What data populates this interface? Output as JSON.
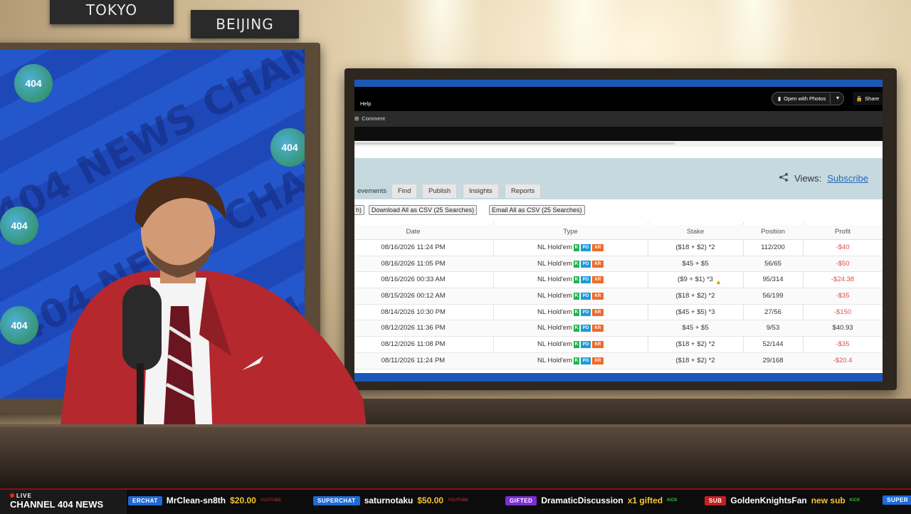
{
  "studio": {
    "city_signs": [
      "TOKYO",
      "BEIJING"
    ],
    "background_text": "404 NEWS CHANNEL",
    "globe_label": "404"
  },
  "app": {
    "topbar": {
      "help_label": "Help",
      "open_with_photos_label": "Open with Photos",
      "share_label": "Share"
    },
    "commandbar": {
      "comment_label": "Comment"
    },
    "header": {
      "views_label": "Views:",
      "subscribe_link": "Subscribe"
    },
    "tabs": [
      {
        "label": "evements"
      },
      {
        "label": "Find"
      },
      {
        "label": "Publish"
      },
      {
        "label": "Insights"
      },
      {
        "label": "Reports"
      }
    ],
    "actions": {
      "partial_button": "h)",
      "download_csv": "Download All as CSV (25 Searches)",
      "email_csv": "Email All as CSV (25 Searches)"
    },
    "table": {
      "columns": [
        "Date",
        "Type",
        "Stake",
        "Position",
        "Profit"
      ],
      "rows": [
        {
          "date": "08/16/2026 11:24 PM",
          "type": "NL Hold'em",
          "stake": "($18 + $2) *2",
          "position": "112/200",
          "profit": "-$40",
          "negative": true
        },
        {
          "date": "08/16/2026 11:05 PM",
          "type": "NL Hold'em",
          "stake": "$45 + $5",
          "position": "56/65",
          "profit": "-$50",
          "negative": true
        },
        {
          "date": "08/16/2026 00:33 AM",
          "type": "NL Hold'em",
          "stake": "($9 + $1) *3",
          "position": "95/314",
          "profit": "-$24.38",
          "negative": true
        },
        {
          "date": "08/15/2026 00:12 AM",
          "type": "NL Hold'em",
          "stake": "($18 + $2) *2",
          "position": "56/199",
          "profit": "-$35",
          "negative": true
        },
        {
          "date": "08/14/2026 10:30 PM",
          "type": "NL Hold'em",
          "stake": "($45 + $5) *3",
          "position": "27/56",
          "profit": "-$150",
          "negative": true
        },
        {
          "date": "08/12/2026 11:36 PM",
          "type": "NL Hold'em",
          "stake": "$45 + $5",
          "position": "9/53",
          "profit": "$40.93",
          "negative": false
        },
        {
          "date": "08/12/2026 11:08 PM",
          "type": "NL Hold'em",
          "stake": "($18 + $2) *2",
          "position": "52/144",
          "profit": "-$35",
          "negative": true
        },
        {
          "date": "08/11/2026 11:24 PM",
          "type": "NL Hold'em",
          "stake": "($18 + $2) *2",
          "position": "29/168",
          "profit": "-$20.4",
          "negative": true
        }
      ]
    }
  },
  "ticker": {
    "live_label": "LIVE",
    "channel_label": "CHANNEL 404 NEWS",
    "items": [
      {
        "tag": "ERCHAT",
        "tag_type": "superchat",
        "user": "MrClean-sn8th",
        "amount": "$20.00",
        "platform": "YOUTUBE"
      },
      {
        "tag": "SUPERCHAT",
        "tag_type": "superchat",
        "user": "saturnotaku",
        "amount": "$50.00",
        "platform": "YOUTUBE"
      },
      {
        "tag": "GIFTED",
        "tag_type": "gifted",
        "user": "DramaticDiscussion",
        "amount": "x1 gifted",
        "platform": "KICK"
      },
      {
        "tag": "SUB",
        "tag_type": "sub",
        "user": "GoldenKnightsFan",
        "amount": "new sub",
        "platform": "KICK"
      },
      {
        "tag": "SUPER",
        "tag_type": "superchat",
        "user": "",
        "amount": "",
        "platform": ""
      }
    ]
  },
  "colors": {
    "accent_blue": "#1a59b7",
    "negative_profit": "#d9534f",
    "ticker_amount": "#f7c531",
    "superchat_tag": "#1e6bd6",
    "gifted_tag": "#7b2fd6",
    "sub_tag": "#c62020"
  }
}
